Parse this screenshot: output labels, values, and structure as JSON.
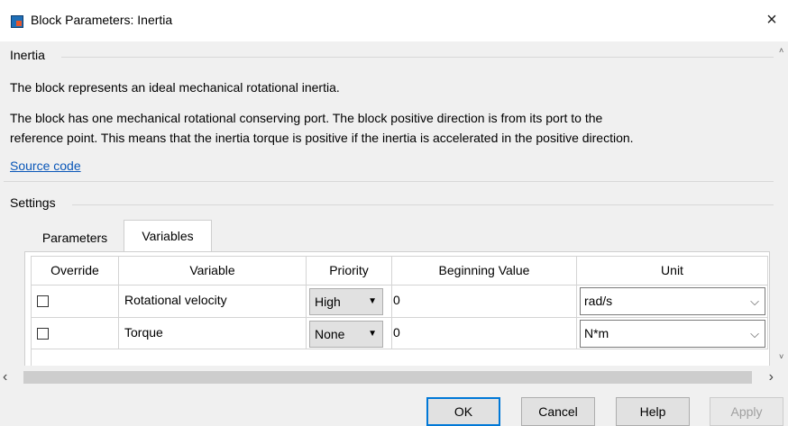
{
  "window": {
    "title": "Block Parameters: Inertia",
    "close_glyph": "×"
  },
  "inertia_group": {
    "title": "Inertia",
    "desc1": "The block represents an ideal mechanical rotational inertia.",
    "desc2": "The block has one mechanical rotational conserving port. The block positive direction is from its port to the",
    "desc3": "reference point. This means that the inertia torque is positive if the inertia is accelerated in the positive direction.",
    "source_link": "Source code"
  },
  "settings_group": {
    "title": "Settings"
  },
  "tabs": [
    {
      "label": "Parameters",
      "active": false
    },
    {
      "label": "Variables",
      "active": true
    }
  ],
  "table": {
    "headers": [
      "Override",
      "Variable",
      "Priority",
      "Beginning Value",
      "Unit"
    ],
    "rows": [
      {
        "override": false,
        "variable": "Rotational velocity",
        "priority": "High",
        "value": "0",
        "unit": "rad/s"
      },
      {
        "override": false,
        "variable": "Torque",
        "priority": "None",
        "value": "0",
        "unit": "N*m"
      }
    ]
  },
  "buttons": {
    "ok": "OK",
    "cancel": "Cancel",
    "help": "Help",
    "apply": "Apply"
  },
  "colors": {
    "link": "#0a57b8",
    "default_button_border": "#0078d7"
  },
  "icons": [
    "simulink-block-icon",
    "close-icon",
    "chevron-down-icon",
    "scroll-left-icon",
    "scroll-right-icon"
  ]
}
